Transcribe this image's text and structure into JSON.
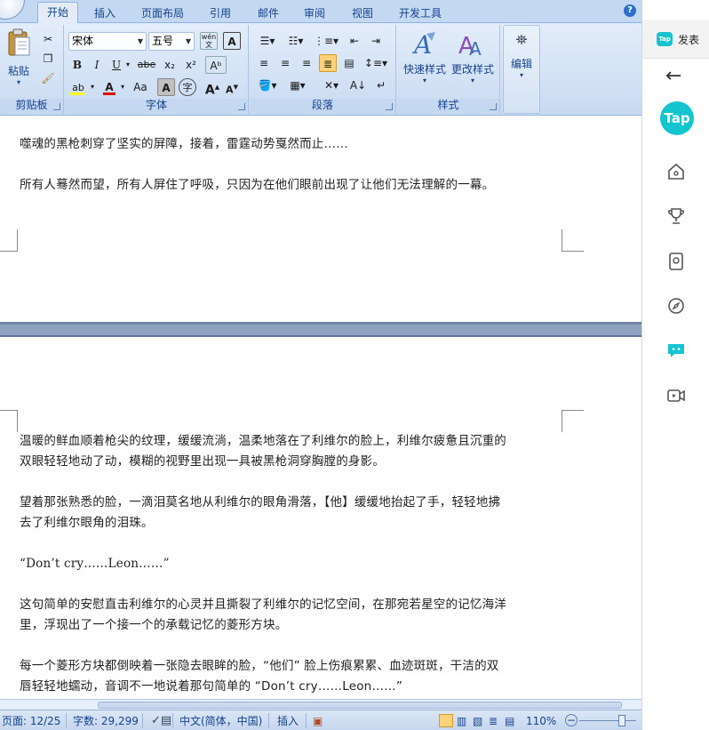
{
  "ribbon": {
    "tabs": [
      "开始",
      "插入",
      "页面布局",
      "引用",
      "邮件",
      "审阅",
      "视图",
      "开发工具"
    ],
    "active_tab": "开始",
    "help": "?",
    "clipboard": {
      "paste_label": "粘贴",
      "group_label": "剪贴板"
    },
    "font": {
      "name": "宋体",
      "size": "五号",
      "group_label": "字体",
      "wen_label": "wén\n文",
      "bold": "B",
      "italic": "I",
      "underline": "U",
      "strike": "abe",
      "sub": "x₂",
      "sup": "x²",
      "grow": "A",
      "shrink": "A",
      "case": "Aa",
      "charbox": "A",
      "circle": "字"
    },
    "paragraph": {
      "group_label": "段落"
    },
    "styles": {
      "quick_label": "快速样式",
      "change_label": "更改样式",
      "group_label": "样式"
    },
    "editing": {
      "label": "编辑"
    }
  },
  "document": {
    "page1": [
      "噬魂的黑枪刺穿了坚实的屏障，接着，雷霆动势戛然而止……",
      "所有人蓦然而望，所有人屏住了呼吸，只因为在他们眼前出现了让他们无法理解的一幕。"
    ],
    "page2": [
      "温暖的鲜血顺着枪尖的纹理，缓缓流淌，温柔地落在了利维尔的脸上，利维尔疲惫且沉重的",
      "双眼轻轻地动了动，模糊的视野里出现一具被黑枪洞穿胸膛的身影。",
      "望着那张熟悉的脸，一滴泪莫名地从利维尔的眼角滑落，【他】缓缓地抬起了手，轻轻地拂",
      "去了利维尔眼角的泪珠。",
      "“Don’t cry……Leon……”",
      "这句简单的安慰直击利维尔的心灵并且撕裂了利维尔的记忆空间，在那宛若星空的记忆海洋",
      "里，浮现出了一个接一个的承载记忆的菱形方块。",
      "每一个菱形方块都倒映着一张隐去眼眸的脸，“他们” 脸上伤痕累累、血迹斑斑，干洁的双",
      "唇轻轻地蠕动，音调不一地说着那句简单的 “Don’t  cry……Leon……”"
    ]
  },
  "status": {
    "page": "页面: 12/25",
    "words": "字数: 29,299",
    "language": "中文(简体，中国)",
    "mode": "插入",
    "zoom": "110%"
  },
  "tap_panel": {
    "tab_title": "发表",
    "logo_text": "Tap",
    "small_logo": "Tap",
    "accent": "#14c5cf"
  }
}
